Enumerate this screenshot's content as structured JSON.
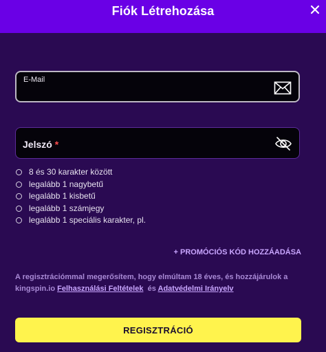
{
  "header": {
    "title": "Fiók Létrehozása"
  },
  "email": {
    "label": "E-Mail",
    "icon": "envelope-icon"
  },
  "password": {
    "label": "Jelszó",
    "required_mark": "*",
    "icon": "eye-off-icon"
  },
  "rules": [
    "8 és 30 karakter között",
    "legalább 1 nagybetű",
    "legalább 1 kisbetű",
    "legalább 1 számjegy",
    "legalább 1 speciális karakter, pl."
  ],
  "promo": {
    "label": "+ PROMÓCIÓS KÓD HOZZÁADÁSA"
  },
  "consent": {
    "text_before": "A regisztrációmmal megerősítem, hogy elmúltam 18 éves, és hozzájárulok a kingspin.io",
    "terms_link": "Felhasználási Feltételek",
    "conjunction": "és",
    "privacy_link": "Adatvédelmi Irányelv"
  },
  "submit": {
    "label": "REGISZTRÁCIÓ"
  },
  "colors": {
    "header": "#6a00e6",
    "background": "#2a0a52",
    "button": "#fff34d",
    "link": "#c9a6ff"
  }
}
